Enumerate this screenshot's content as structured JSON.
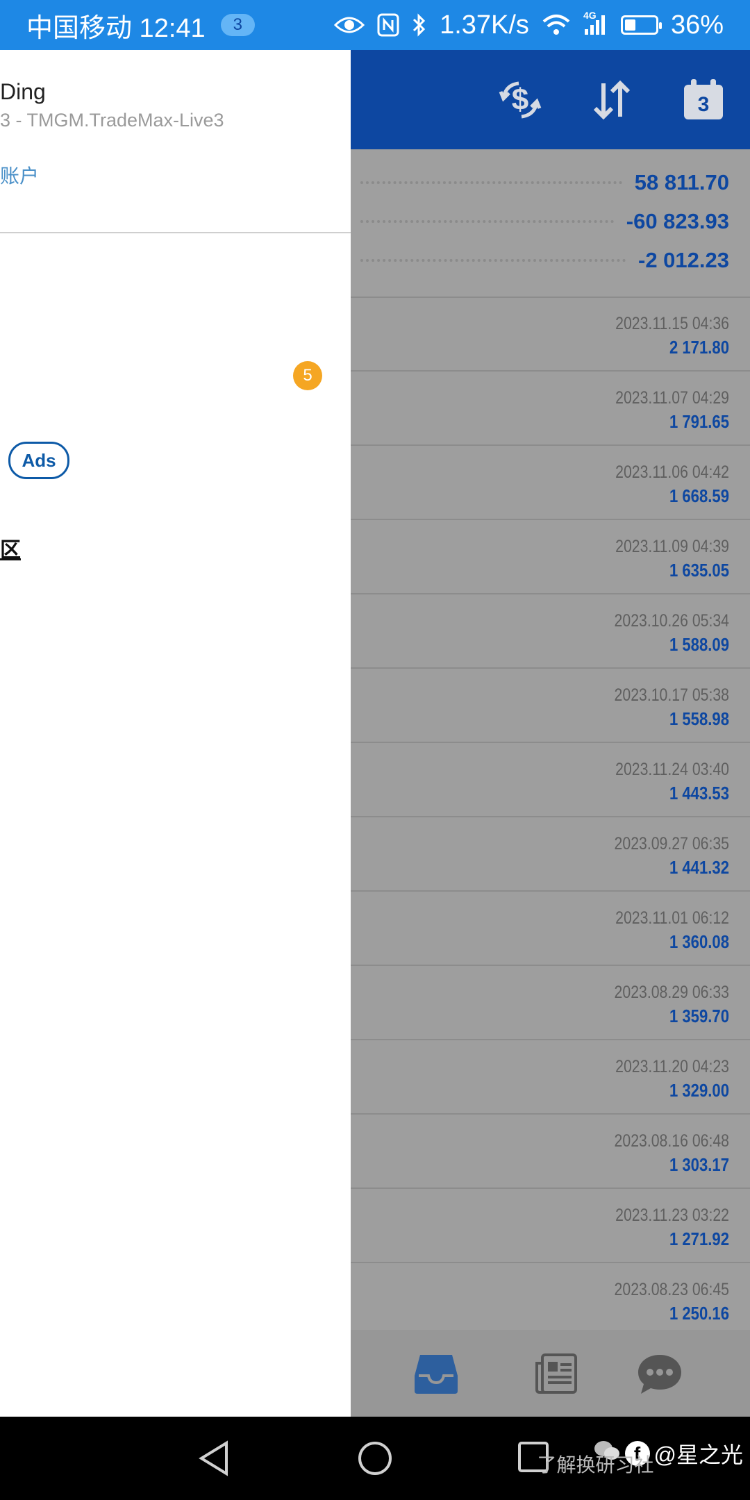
{
  "status_bar": {
    "carrier_time": "中国移动 12:41",
    "notification_count": "3",
    "network_speed": "1.37K/s",
    "signal_label": "4G",
    "battery": "36%",
    "battery_level": 0.36
  },
  "header": {
    "calendar_day": "3"
  },
  "summary": {
    "rows": [
      "58 811.70",
      "-60 823.93",
      "-2 012.23"
    ]
  },
  "deals": [
    {
      "date": "2023.11.15 04:36",
      "amount": "2 171.80"
    },
    {
      "date": "2023.11.07 04:29",
      "amount": "1 791.65"
    },
    {
      "date": "2023.11.06 04:42",
      "amount": "1 668.59"
    },
    {
      "date": "2023.11.09 04:39",
      "amount": "1 635.05"
    },
    {
      "date": "2023.10.26 05:34",
      "amount": "1 588.09"
    },
    {
      "date": "2023.10.17 05:38",
      "amount": "1 558.98"
    },
    {
      "date": "2023.11.24 03:40",
      "amount": "1 443.53"
    },
    {
      "date": "2023.09.27 06:35",
      "amount": "1 441.32"
    },
    {
      "date": "2023.11.01 06:12",
      "amount": "1 360.08"
    },
    {
      "date": "2023.08.29 06:33",
      "amount": "1 359.70"
    },
    {
      "date": "2023.11.20 04:23",
      "amount": "1 329.00"
    },
    {
      "date": "2023.08.16 06:48",
      "amount": "1 303.17"
    },
    {
      "date": "2023.11.23 03:22",
      "amount": "1 271.92"
    },
    {
      "date": "2023.08.23 06:45",
      "amount": "1 250.16"
    }
  ],
  "drawer": {
    "user_name": "Ding",
    "account_line": "3 - TMGM.TradeMax-Live3",
    "manage_link": "账户",
    "badge": "5",
    "ads_label": "Ads",
    "glyph": "区"
  },
  "watermark": {
    "handle": "@星之光",
    "sub": "了解换研习社"
  },
  "colors": {
    "status_bar": "#1e88e5",
    "header": "#0d47a1",
    "accent_blue": "#0d47a1",
    "badge_orange": "#f5a623"
  }
}
